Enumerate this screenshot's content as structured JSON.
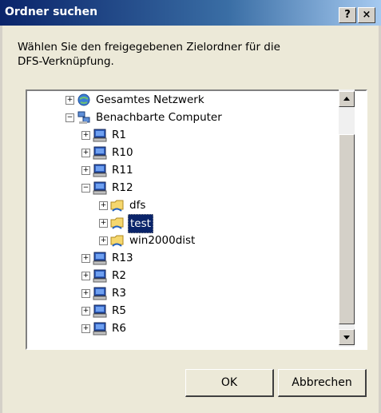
{
  "window": {
    "title": "Ordner suchen",
    "help_label": "?",
    "close_label": "×"
  },
  "instruction": {
    "line1": "Wählen Sie den freigegebenen Zielordner für die",
    "line2": "DFS-Verknüpfung."
  },
  "tree": {
    "items": [
      {
        "label": "Gesamtes Netzwerk",
        "icon": "network-globe-icon",
        "expander": "+"
      },
      {
        "label": "Benachbarte Computer",
        "icon": "network-computers-icon",
        "expander": "−"
      },
      {
        "label": "R1",
        "icon": "computer-icon",
        "expander": "+"
      },
      {
        "label": "R10",
        "icon": "computer-icon",
        "expander": "+"
      },
      {
        "label": "R11",
        "icon": "computer-icon",
        "expander": "+"
      },
      {
        "label": "R12",
        "icon": "computer-icon",
        "expander": "−"
      },
      {
        "label": "dfs",
        "icon": "shared-folder-icon",
        "expander": "+"
      },
      {
        "label": "test",
        "icon": "shared-folder-icon",
        "expander": "+",
        "selected": true
      },
      {
        "label": "win2000dist",
        "icon": "shared-folder-icon",
        "expander": "+"
      },
      {
        "label": "R13",
        "icon": "computer-icon",
        "expander": "+"
      },
      {
        "label": "R2",
        "icon": "computer-icon",
        "expander": "+"
      },
      {
        "label": "R3",
        "icon": "computer-icon",
        "expander": "+"
      },
      {
        "label": "R5",
        "icon": "computer-icon",
        "expander": "+"
      },
      {
        "label": "R6",
        "icon": "computer-icon",
        "expander": "+"
      }
    ]
  },
  "buttons": {
    "ok": "OK",
    "cancel": "Abbrechen"
  },
  "colors": {
    "titlebar": "#0a246a",
    "selection": "#0a246a",
    "face": "#ece9d8"
  }
}
